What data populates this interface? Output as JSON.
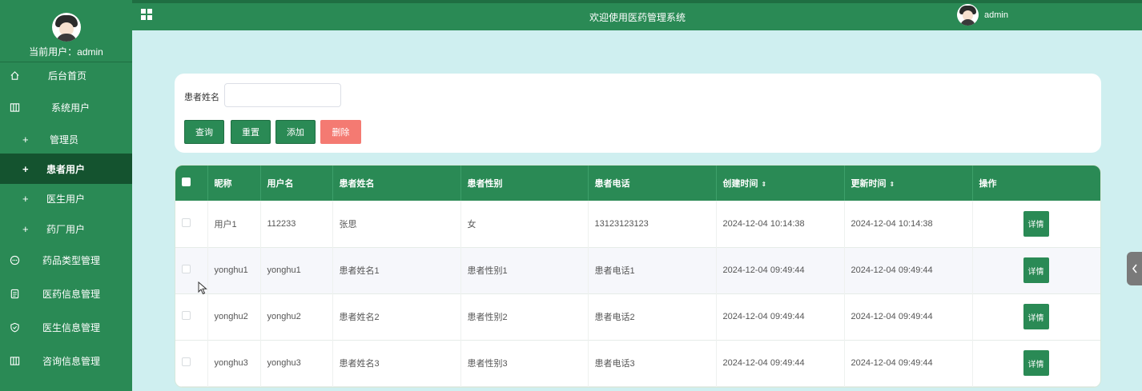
{
  "header": {
    "title": "欢迎使用医药管理系统",
    "username": "admin"
  },
  "sidebar": {
    "current_user_label": "当前用户：admin",
    "items": [
      {
        "label": "后台首页",
        "icon": "home-icon"
      },
      {
        "label": "系统用户",
        "icon": "columns-icon"
      },
      {
        "label": "管理员",
        "icon": "plus-icon"
      },
      {
        "label": "患者用户",
        "icon": "plus-icon"
      },
      {
        "label": "医生用户",
        "icon": "plus-icon"
      },
      {
        "label": "药厂用户",
        "icon": "plus-icon"
      },
      {
        "label": "药品类型管理",
        "icon": "chat-icon"
      },
      {
        "label": "医药信息管理",
        "icon": "document-icon"
      },
      {
        "label": "医生信息管理",
        "icon": "shield-icon"
      },
      {
        "label": "咨询信息管理",
        "icon": "columns-icon"
      }
    ]
  },
  "search": {
    "name_label": "患者姓名",
    "name_value": "",
    "buttons": {
      "query": "查询",
      "reset": "重置",
      "add": "添加",
      "delete": "删除"
    }
  },
  "table": {
    "columns": [
      "昵称",
      "用户名",
      "患者姓名",
      "患者性别",
      "患者电话",
      "创建时间",
      "更新时间",
      "操作"
    ],
    "sort_icon": "⇕",
    "rows": [
      {
        "nickname": "用户1",
        "username": "112233",
        "name": "张思",
        "gender": "女",
        "phone": "13123123123",
        "created": "2024-12-04 10:14:38",
        "updated": "2024-12-04 10:14:38",
        "action": "详情"
      },
      {
        "nickname": "yonghu1",
        "username": "yonghu1",
        "name": "患者姓名1",
        "gender": "患者性别1",
        "phone": "患者电话1",
        "created": "2024-12-04 09:49:44",
        "updated": "2024-12-04 09:49:44",
        "action": "详情"
      },
      {
        "nickname": "yonghu2",
        "username": "yonghu2",
        "name": "患者姓名2",
        "gender": "患者性别2",
        "phone": "患者电话2",
        "created": "2024-12-04 09:49:44",
        "updated": "2024-12-04 09:49:44",
        "action": "详情"
      },
      {
        "nickname": "yonghu3",
        "username": "yonghu3",
        "name": "患者姓名3",
        "gender": "患者性别3",
        "phone": "患者电话3",
        "created": "2024-12-04 09:49:44",
        "updated": "2024-12-04 09:49:44",
        "action": "详情"
      }
    ]
  },
  "colors": {
    "primary": "#2a8a55",
    "active": "#14532f",
    "danger": "#f47a72",
    "background": "#cfeff0"
  }
}
